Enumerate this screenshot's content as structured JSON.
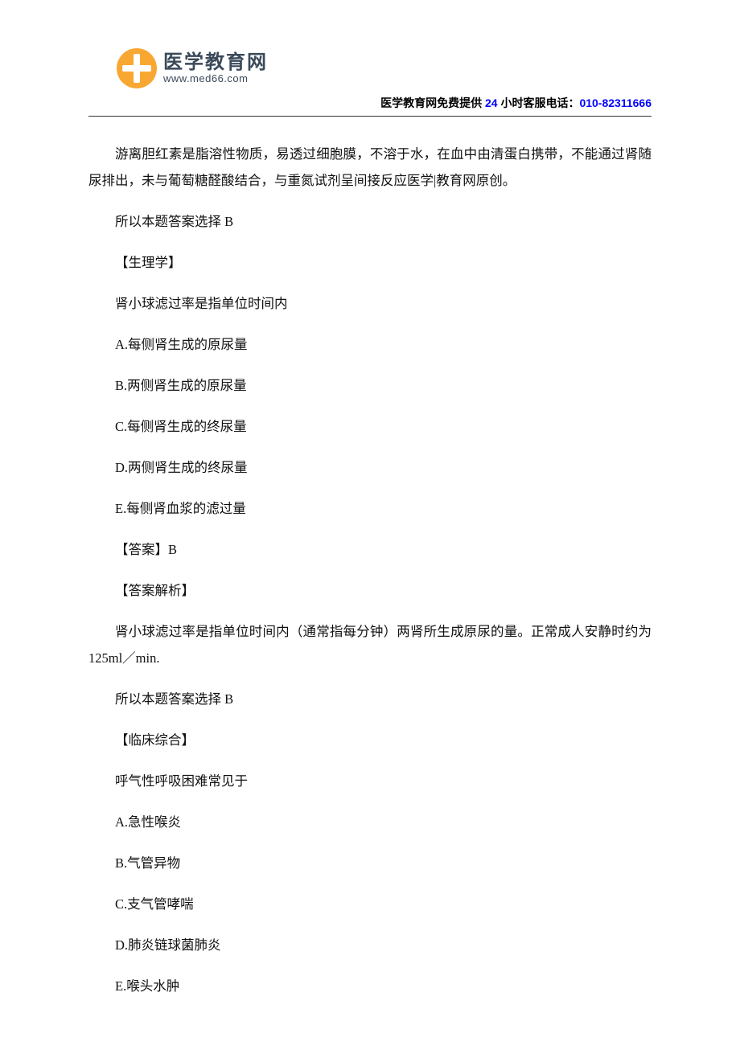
{
  "logo": {
    "title": "医学教育网",
    "url": "www.med66.com"
  },
  "header": {
    "provider_label": "医学教育网免费提供 ",
    "hotline_prefix": "24 ",
    "hotline_label": "小时客服电话：",
    "hotline_number": "010-82311666"
  },
  "body": {
    "p01": "游离胆红素是脂溶性物质，易透过细胞膜，不溶于水，在血中由清蛋白携带，不能通过肾随尿排出，未与葡萄糖醛酸结合，与重氮试剂呈间接反应医学|教育网原创。",
    "p02": "所以本题答案选择 B",
    "p03": "【生理学】",
    "p04": "肾小球滤过率是指单位时间内",
    "p05": "A.每侧肾生成的原尿量",
    "p06": "B.两侧肾生成的原尿量",
    "p07": "C.每侧肾生成的终尿量",
    "p08": "D.两侧肾生成的终尿量",
    "p09": "E.每侧肾血浆的滤过量",
    "p10": "【答案】B",
    "p11": "【答案解析】",
    "p12": "肾小球滤过率是指单位时间内（通常指每分钟）两肾所生成原尿的量。正常成人安静时约为 125ml／min.",
    "p13": "所以本题答案选择 B",
    "p14": "【临床综合】",
    "p15": "呼气性呼吸困难常见于",
    "p16": "A.急性喉炎",
    "p17": "B.气管异物",
    "p18": "C.支气管哮喘",
    "p19": "D.肺炎链球菌肺炎",
    "p20": "E.喉头水肿"
  }
}
